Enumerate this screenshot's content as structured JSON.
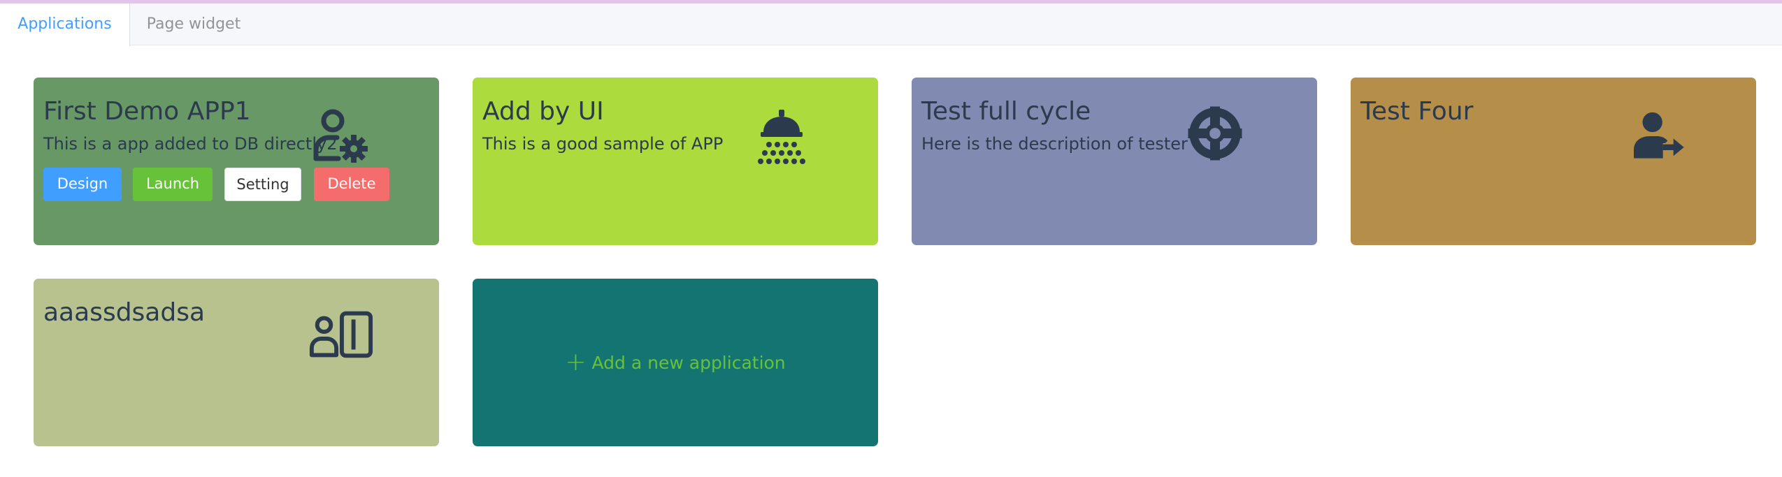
{
  "tabs": [
    {
      "label": "Applications",
      "active": true
    },
    {
      "label": "Page widget",
      "active": false
    }
  ],
  "apps": [
    {
      "title": "First Demo APP1",
      "description": "This is a app added to DB directly2",
      "color": "#679866",
      "icon": "user-gear-icon",
      "buttons": {
        "design": "Design",
        "launch": "Launch",
        "setting": "Setting",
        "delete": "Delete"
      }
    },
    {
      "title": "Add by UI",
      "description": "This is a good sample of APP",
      "color": "#acdb3d",
      "icon": "shower-icon"
    },
    {
      "title": "Test full cycle",
      "description": "Here is the description of tester",
      "color": "#818ab1",
      "icon": "life-ring-icon"
    },
    {
      "title": "Test Four",
      "description": "",
      "color": "#b58f4a",
      "icon": "user-arrow-icon"
    },
    {
      "title": "aaassdsadsa",
      "description": "",
      "color": "#b8c28e",
      "icon": "id-card-icon"
    }
  ],
  "add_card": {
    "label": "Add a new application",
    "color": "#137472",
    "icon": "plus-icon"
  }
}
